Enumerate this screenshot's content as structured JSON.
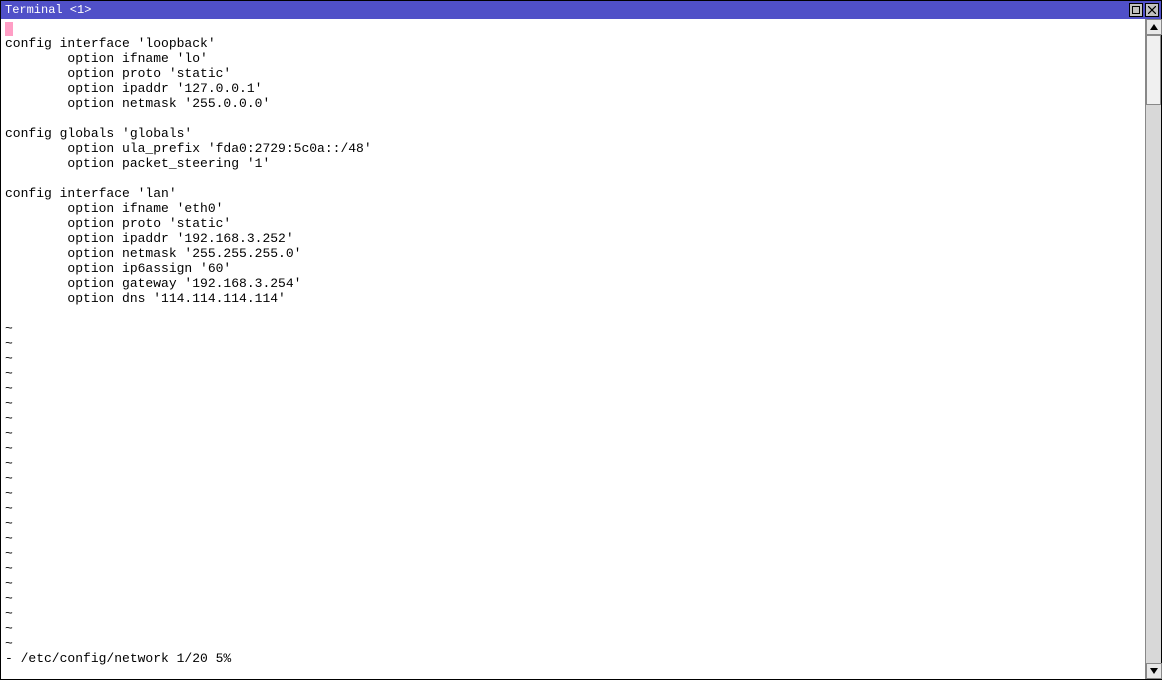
{
  "window": {
    "title": "Terminal <1>"
  },
  "editor": {
    "lines": [
      "",
      "config interface 'loopback'",
      "        option ifname 'lo'",
      "        option proto 'static'",
      "        option ipaddr '127.0.0.1'",
      "        option netmask '255.0.0.0'",
      "",
      "config globals 'globals'",
      "        option ula_prefix 'fda0:2729:5c0a::/48'",
      "        option packet_steering '1'",
      "",
      "config interface 'lan'",
      "        option ifname 'eth0'",
      "        option proto 'static'",
      "        option ipaddr '192.168.3.252'",
      "        option netmask '255.255.255.0'",
      "        option ip6assign '60'",
      "        option gateway '192.168.3.254'",
      "        option dns '114.114.114.114'",
      ""
    ],
    "tilde": "~",
    "status": "- /etc/config/network 1/20 5%"
  }
}
